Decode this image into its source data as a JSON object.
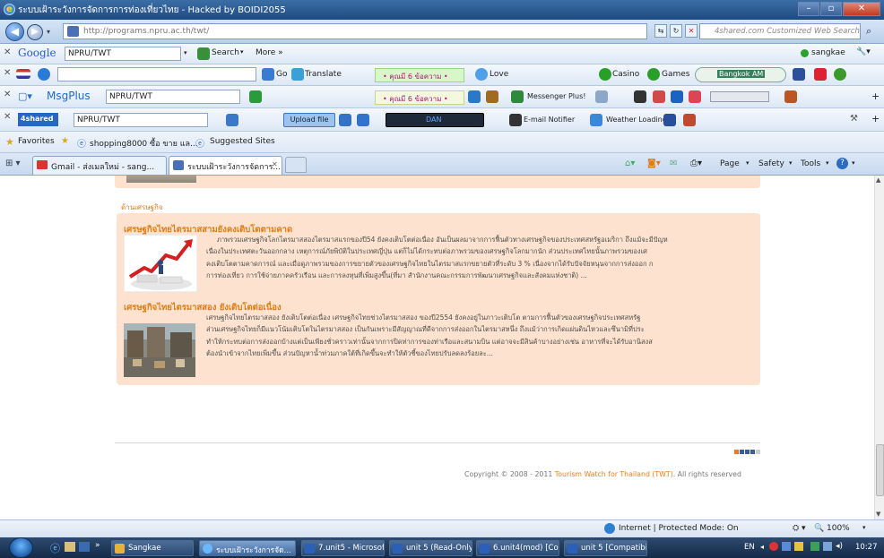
{
  "window": {
    "title": "ระบบเฝ้าระวังการจัดการการท่องเที่ยวไทย - Hacked by BOIDI2055",
    "url": "http://programs.npru.ac.th/twt/",
    "search_placeholder": "4shared.com Customized Web Search"
  },
  "google_toolbar": {
    "brand": "Google",
    "query": "NPRU/TWT",
    "search_label": "Search",
    "more_label": "More »",
    "user": "sangkae"
  },
  "toolbar2": {
    "go_label": "Go",
    "translate_label": "Translate",
    "ticker": "• คุณมี 6 ข้อความ •",
    "love_label": "Love",
    "casino_label": "Casino",
    "games_label": "Games",
    "radio_label": "Bangkok AM"
  },
  "toolbar3": {
    "brand": "MsgPlus",
    "query": "NPRU/TWT",
    "ticker": "• คุณมี 6 ข้อความ •",
    "messenger_label": "Messenger Plus!"
  },
  "toolbar4": {
    "brand": "4shared",
    "query": "NPRU/TWT",
    "upload_label": "Upload file",
    "dan_label": "DAN",
    "email_label": "E-mail Notifier",
    "weather_label": "Weather Loading ..."
  },
  "favbar": {
    "favorites_label": "Favorites",
    "item1": "shopping8000 ซื้อ ขาย แล...",
    "item2": "Suggested Sites"
  },
  "tabs": [
    {
      "label": "Gmail - ส่งเมลใหม่ - sang..."
    },
    {
      "label": "ระบบเฝ้าระวังการจัดการ..."
    }
  ],
  "cmdbar": {
    "page": "Page",
    "safety": "Safety",
    "tools": "Tools"
  },
  "section": {
    "label": "ด้านเศรษฐกิจ"
  },
  "articles": [
    {
      "title": "เศรษฐกิจไทยไตรมาสสามยังคงเติบโตตามคาด",
      "lines": [
        "ภาพรวมเศรษฐกิจโลกไตรมาสสองไตรมาสแรกของปี54 ยังคงเติบโตต่อเนื่อง อันเป็นผลมาจากการฟื้นตัวทางเศรษฐกิจของประเทศสหรัฐอเมริกา ถึงแม้จะมีปัญห",
        "เนื่องในประเทศตะวันออกกลาง เหตุการณ์ภัยพิบัติในประเทศญี่ปุ่น แต่ก็ไม่ได้กระทบต่อภาพรวมของเศรษฐกิจโลกมากนัก ส่วนประเทศไทยนั้นภาพรวมของเศ",
        "คงเติบโตตามคาดการณ์ และเมื่อดูภาพรวมของการขยายตัวของเศรษฐกิจไทยในไตรมาสแรกขยายตัวที่ระดับ 3 % เนื่องจากได้รับปัจจัยหนุนจากการส่งออก ก",
        "การท่องเที่ยว การใช้จ่ายภาคครัวเรือน และการลงทุนที่เพิ่มสูงขึ้น(ที่มา สำนักงานคณะกรรมการพัฒนาเศรษฐกิจและสังคมแห่งชาติ) ..."
      ]
    },
    {
      "title": "เศรษฐกิจไทยไตรมาสสอง ยังเติบโตต่อเนื่อง",
      "lines": [
        "เศรษฐกิจไทยไตรมาสสอง ยังเติบโตต่อเนื่อง   เศรษฐกิจไทยช่วงไตรมาสสอง ของปี2554 ยังคงอยู่ในภาวะเติบโต ตามการฟื้นตัวของเศรษฐกิจประเทศสหรัฐ",
        "ส่วนเศรษฐกิจไทยก็มีแนวโน้มเติบโตในไตรมาสสอง เป็นกันเพราะมีสัญญาณที่ดีจากการส่งออกในไตรมาสหนึ่ง  ถึงแม้ว่าการเกิดแผ่นดินไหวและซึนามิที่ประ",
        "ทำให้กระทบต่อการส่งออกบ้างแต่เป็นเพียงชั่วคราวเท่านั้นจากการปิดท่าการของท่าเรือและสนามบิน  แต่อาจจะมีสินค้าบางอย่างเช่น อาหารที่จะได้รับอานิสงส",
        "ต้องนำเข้าจากไทยเพิ่มขึ้น  ส่วนปัญหาน้ำท่วมภาคใต้ที่เกิดขึ้นจะทำให้ตัวชี้ของไทยปรับลดลงร้อยละ..."
      ]
    }
  ],
  "footer": {
    "copyright_prefix": "Copyright © 2008 - 2011 ",
    "copyright_link": "Tourism Watch for Thailand (TWT)",
    "copyright_suffix": ". All rights reserved"
  },
  "status": {
    "zone": "Internet | Protected Mode: On",
    "zoom": "100%"
  },
  "taskbar": {
    "items": [
      "Sangkae",
      "ระบบเฝ้าระวังการจัด...",
      "7.unit5 - Microsof...",
      "unit 5 (Read-Only)...",
      "6.unit4(mod) [Co...",
      "unit 5 [Compatibil..."
    ],
    "lang": "EN",
    "time": "10:27"
  },
  "colors": {
    "accent_orange": "#e07d16",
    "panel_bg": "#fde3cf"
  }
}
